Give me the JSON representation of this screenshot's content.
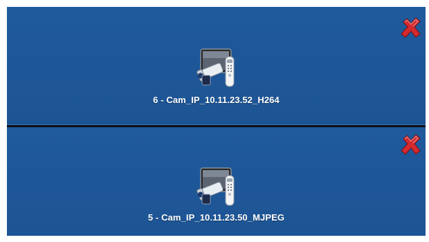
{
  "cameras": [
    {
      "label": "6 - Cam_IP_10.11.23.52_H264",
      "icon": "ip-camera-icon",
      "close_icon": "close-icon"
    },
    {
      "label": "5 - Cam_IP_10.11.23.50_MJPEG",
      "icon": "ip-camera-icon",
      "close_icon": "close-icon"
    }
  ],
  "colors": {
    "panel_background": "#1e5799",
    "divider": "#0b0f18",
    "close_red": "#d0212a",
    "label_text": "#ffffff"
  }
}
